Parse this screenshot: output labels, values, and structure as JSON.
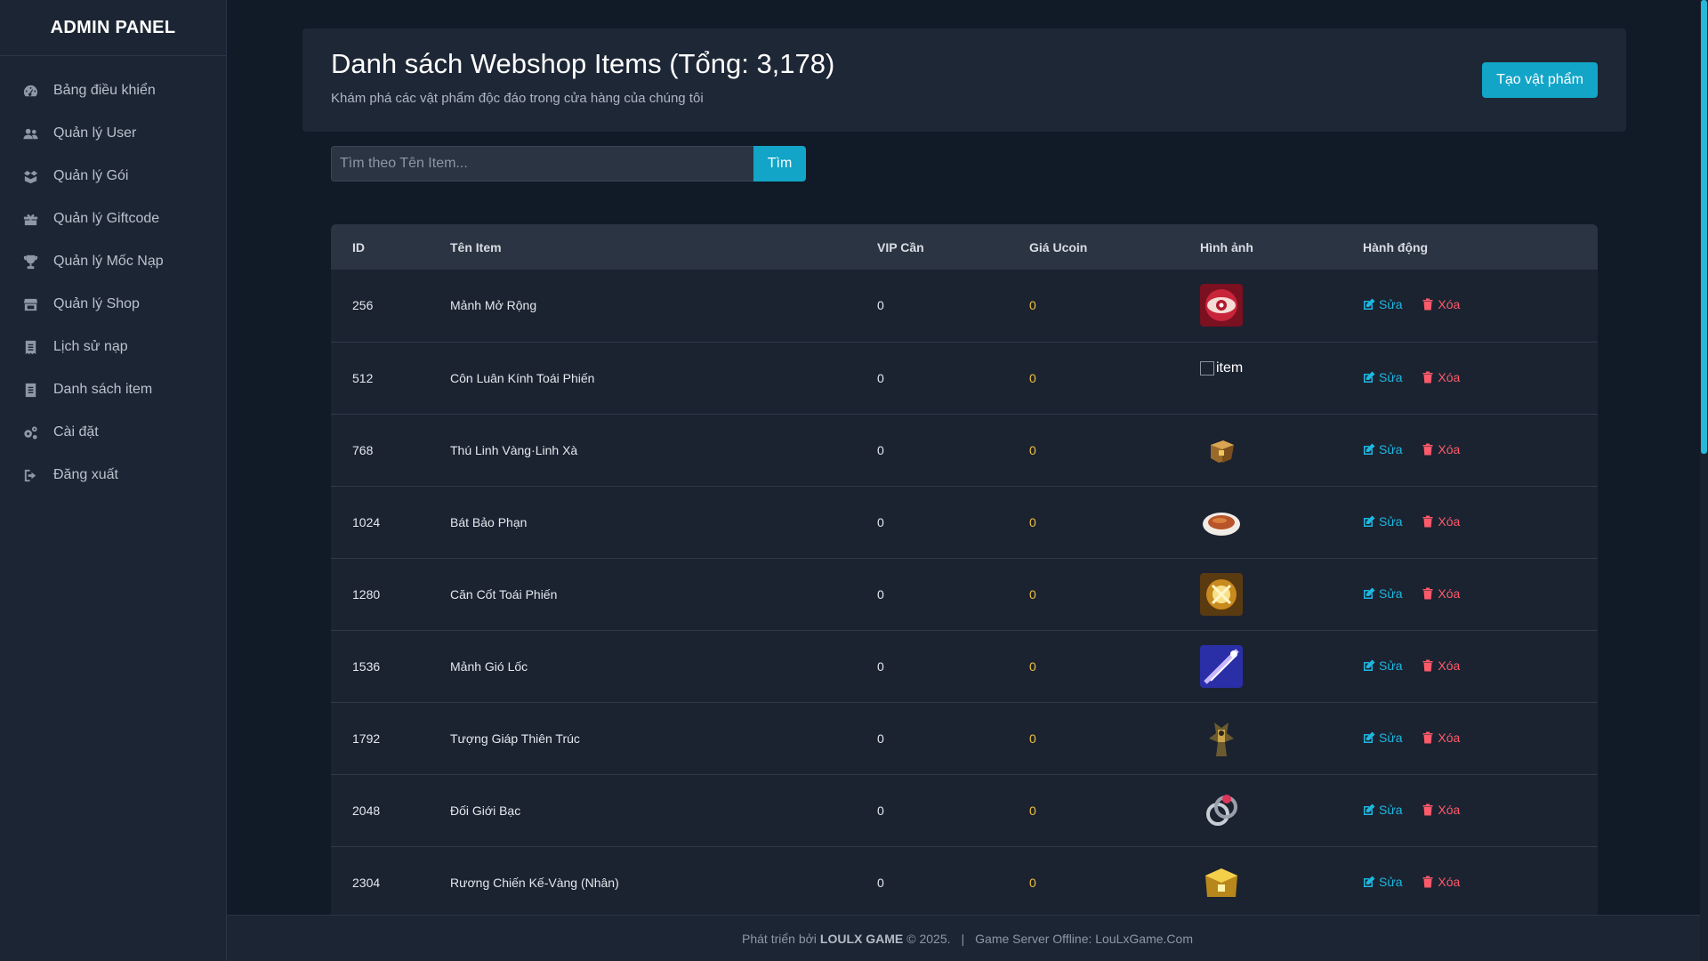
{
  "sidebar": {
    "brand": "ADMIN PANEL",
    "items": [
      {
        "label": "Bảng điều khiển",
        "icon": "dashboard-icon"
      },
      {
        "label": "Quản lý User",
        "icon": "users-icon"
      },
      {
        "label": "Quản lý Gói",
        "icon": "package-icon"
      },
      {
        "label": "Quản lý Giftcode",
        "icon": "gift-icon"
      },
      {
        "label": "Quản lý Mốc Nạp",
        "icon": "trophy-icon"
      },
      {
        "label": "Quản lý Shop",
        "icon": "store-icon"
      },
      {
        "label": "Lịch sử nạp",
        "icon": "receipt-icon"
      },
      {
        "label": "Danh sách item",
        "icon": "list-icon"
      },
      {
        "label": "Cài đặt",
        "icon": "gears-icon"
      },
      {
        "label": "Đăng xuất",
        "icon": "logout-icon"
      }
    ]
  },
  "header": {
    "title": "Danh sách Webshop Items (Tổng: 3,178)",
    "subtitle": "Khám phá các vật phẩm độc đáo trong cửa hàng của chúng tôi",
    "create_label": "Tạo vật phẩm"
  },
  "search": {
    "placeholder": "Tìm theo Tên Item...",
    "value": "",
    "button_label": "Tìm"
  },
  "table": {
    "columns": [
      "ID",
      "Tên Item",
      "VIP Cần",
      "Giá Ucoin",
      "Hình ảnh",
      "Hành động"
    ],
    "edit_label": "Sửa",
    "delete_label": "Xóa",
    "broken_image_alt": "item",
    "rows": [
      {
        "id": "256",
        "name": "Mảnh Mở Rộng",
        "vip": "0",
        "price": "0"
      },
      {
        "id": "512",
        "name": "Côn Luân Kính Toái Phiến",
        "vip": "0",
        "price": "0"
      },
      {
        "id": "768",
        "name": "Thú Linh Vàng·Linh Xà",
        "vip": "0",
        "price": "0"
      },
      {
        "id": "1024",
        "name": "Bát Bảo Phạn",
        "vip": "0",
        "price": "0"
      },
      {
        "id": "1280",
        "name": "Căn Cốt Toái Phiến",
        "vip": "0",
        "price": "0"
      },
      {
        "id": "1536",
        "name": "Mảnh Gió Lốc",
        "vip": "0",
        "price": "0"
      },
      {
        "id": "1792",
        "name": "Tượng Giáp Thiên Trúc",
        "vip": "0",
        "price": "0"
      },
      {
        "id": "2048",
        "name": "Đối Giới Bạc",
        "vip": "0",
        "price": "0"
      },
      {
        "id": "2304",
        "name": "Rương Chiến Kế-Vàng (Nhân)",
        "vip": "0",
        "price": "0"
      }
    ]
  },
  "footer": {
    "prefix": "Phát triển bởi",
    "brand": "LOULX GAME",
    "year": "© 2025.",
    "separator": "|",
    "server": "Game Server Offline: LouLxGame.Com"
  },
  "colors": {
    "accent": "#12a5c8",
    "price": "#f2c037",
    "delete": "#ff5a6a",
    "edit": "#1fb7e0"
  }
}
